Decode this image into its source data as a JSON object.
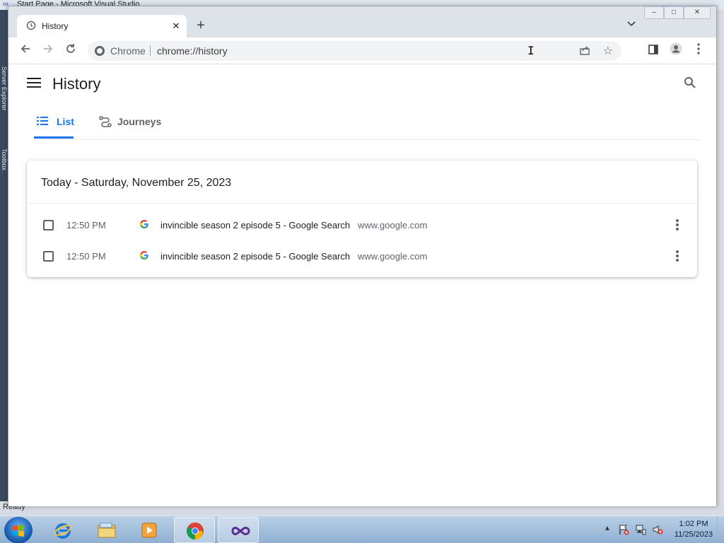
{
  "background_window": {
    "title": "Start Page - Microsoft Visual Studio",
    "side_labels": [
      "Server Explorer",
      "Toolbox"
    ],
    "status": "Ready"
  },
  "browser": {
    "tab": {
      "title": "History",
      "icon": "history-icon"
    },
    "omnibox": {
      "chip": "Chrome",
      "url": "chrome://history"
    },
    "window_controls": {
      "minimize": "–",
      "maximize": "□",
      "close": "✕"
    }
  },
  "page": {
    "title": "History",
    "tabs": [
      {
        "label": "List",
        "icon": "list-icon",
        "active": true
      },
      {
        "label": "Journeys",
        "icon": "journeys-icon",
        "active": false
      }
    ],
    "section_header": "Today - Saturday, November 25, 2023",
    "entries": [
      {
        "time": "12:50 PM",
        "title": "invincible season 2 episode 5 - Google Search",
        "domain": "www.google.com",
        "favicon": "google-favicon"
      },
      {
        "time": "12:50 PM",
        "title": "invincible season 2 episode 5 - Google Search",
        "domain": "www.google.com",
        "favicon": "google-favicon"
      }
    ]
  },
  "taskbar": {
    "apps": [
      "internet-explorer-icon",
      "file-explorer-icon",
      "media-player-icon",
      "chrome-icon",
      "visual-studio-icon"
    ],
    "active_app": "chrome-icon",
    "clock": {
      "time": "1:02 PM",
      "date": "11/25/2023"
    }
  },
  "colors": {
    "accent": "#1a73e8",
    "text_primary": "#202124",
    "text_secondary": "#5f6368",
    "tab_strip": "#dee3ea"
  }
}
